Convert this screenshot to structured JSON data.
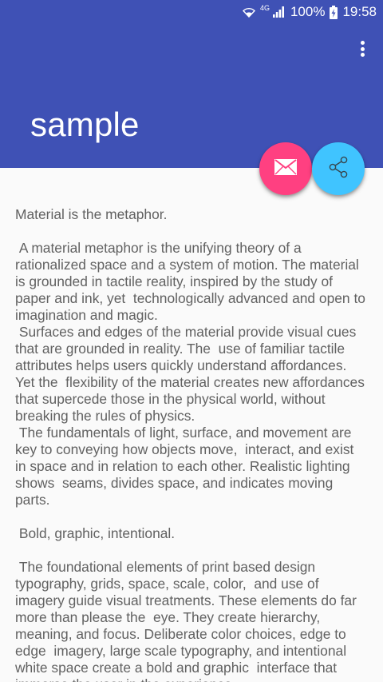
{
  "status_bar": {
    "network_type": "4G",
    "battery": "100%",
    "time": "19:58"
  },
  "toolbar": {
    "title": "sample",
    "overflow_icon": "more-vert-icon"
  },
  "fabs": {
    "mail_icon": "mail-icon",
    "share_icon": "share-icon",
    "mail_color": "#ff4081",
    "share_color": "#40c4ff"
  },
  "colors": {
    "primary": "#3f51b5",
    "background": "#fafafa",
    "text": "#616161"
  },
  "content": {
    "text": "Material is the metaphor.\n\n A material metaphor is the unifying theory of a rationalized space and a system of motion. The material is grounded in tactile reality, inspired by the study of paper and ink, yet  technologically advanced and open to imagination and magic.\n Surfaces and edges of the material provide visual cues that are grounded in reality. The  use of familiar tactile attributes helps users quickly understand affordances. Yet the  flexibility of the material creates new affordances that supercede those in the physical world, without breaking the rules of physics.\n The fundamentals of light, surface, and movement are key to conveying how objects move,  interact, and exist in space and in relation to each other. Realistic lighting shows  seams, divides space, and indicates moving parts.\n\n Bold, graphic, intentional.\n\n The foundational elements of print based design typography, grids, space, scale, color,  and use of imagery guide visual treatments. These elements do far more than please the  eye. They create hierarchy, meaning, and focus. Deliberate color choices, edge to edge  imagery, large scale typography, and intentional white space create a bold and graphic  interface that immerse the user in the experience."
  }
}
